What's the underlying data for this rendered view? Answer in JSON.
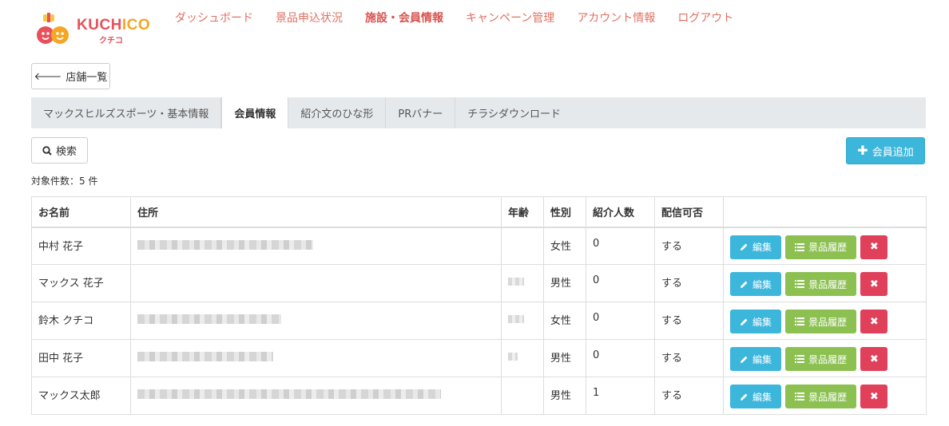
{
  "logo": {
    "text": "KUCHICO",
    "sub": "クチコ"
  },
  "nav": [
    {
      "label": "ダッシュボード",
      "active": false
    },
    {
      "label": "景品申込状況",
      "active": false
    },
    {
      "label": "施設・会員情報",
      "active": true
    },
    {
      "label": "キャンペーン管理",
      "active": false
    },
    {
      "label": "アカウント情報",
      "active": false
    },
    {
      "label": "ログアウト",
      "active": false
    }
  ],
  "back_button": "店舗一覧",
  "tabs": [
    {
      "label": "マックスヒルズスポーツ・基本情報",
      "active": false
    },
    {
      "label": "会員情報",
      "active": true
    },
    {
      "label": "紹介文のひな形",
      "active": false
    },
    {
      "label": "PRバナー",
      "active": false
    },
    {
      "label": "チラシダウンロード",
      "active": false
    }
  ],
  "search_button": "検索",
  "add_button": "会員追加",
  "count_label": "対象件数：5 件",
  "table": {
    "headers": [
      "お名前",
      "住所",
      "年齢",
      "性別",
      "紹介人数",
      "配信可否",
      ""
    ],
    "rows": [
      {
        "name": "中村 花子",
        "gender": "女性",
        "referrals": "0",
        "delivery": "する"
      },
      {
        "name": "マックス 花子",
        "gender": "男性",
        "referrals": "0",
        "delivery": "する"
      },
      {
        "name": "鈴木 クチコ",
        "gender": "女性",
        "referrals": "0",
        "delivery": "する"
      },
      {
        "name": "田中 花子",
        "gender": "男性",
        "referrals": "0",
        "delivery": "する"
      },
      {
        "name": "マックス太郎",
        "gender": "男性",
        "referrals": "1",
        "delivery": "する"
      }
    ]
  },
  "row_actions": {
    "edit": "編集",
    "history": "景品履歴",
    "delete": "✖"
  },
  "colors": {
    "accent": "#3db6dc",
    "nav": "#e07060",
    "history": "#8cc152",
    "delete": "#e0405a"
  }
}
